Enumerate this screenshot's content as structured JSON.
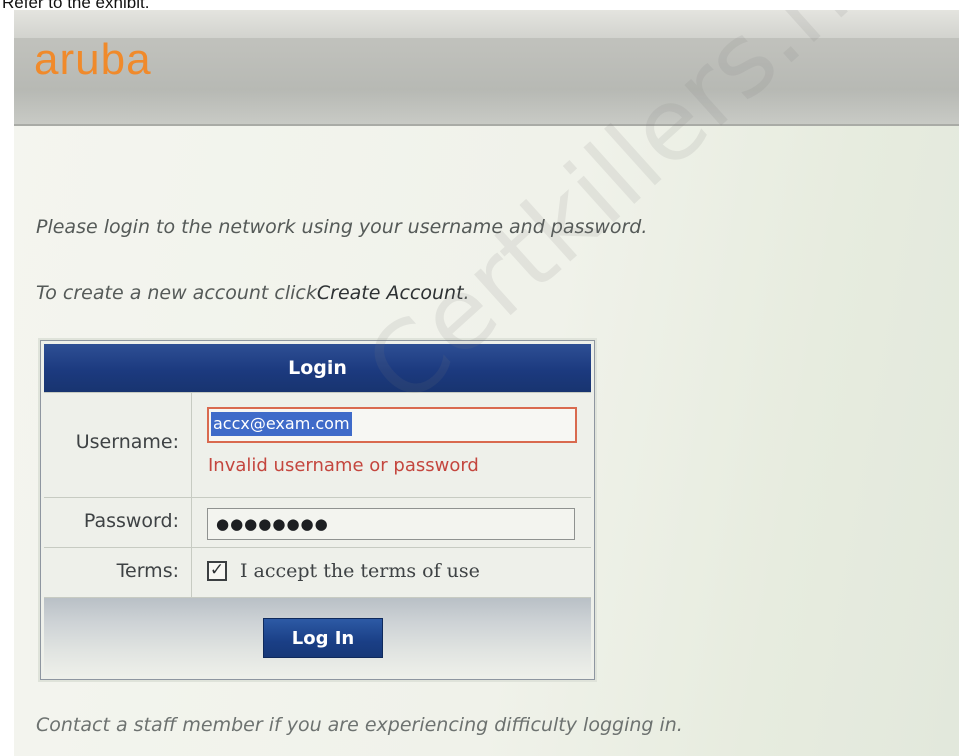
{
  "caption": "Refer to the exhibit.",
  "header": {
    "logo_text": "aruba",
    "logo_color": "#f08a2b"
  },
  "intro": {
    "line1": "Please login to the network using your username and password.",
    "line2_prefix": "To create a new account click",
    "line2_link": "Create Account",
    "line2_suffix": "."
  },
  "login": {
    "title": "Login",
    "username_label": "Username:",
    "username_value": "accx@exam.com",
    "error_message": "Invalid username or password",
    "password_label": "Password:",
    "password_mask": "●●●●●●●●",
    "terms_label": "Terms:",
    "terms_checkbox_mark": "✓",
    "terms_text": "I accept the terms of use",
    "button_label": "Log In"
  },
  "footer": {
    "text": "Contact a staff member if you are experiencing difficulty logging in."
  },
  "watermark": "Certkillers.net",
  "colors": {
    "header_blue": "#1c3a7f",
    "error_red": "#c4463e",
    "selection_blue": "#3f6bc9"
  }
}
